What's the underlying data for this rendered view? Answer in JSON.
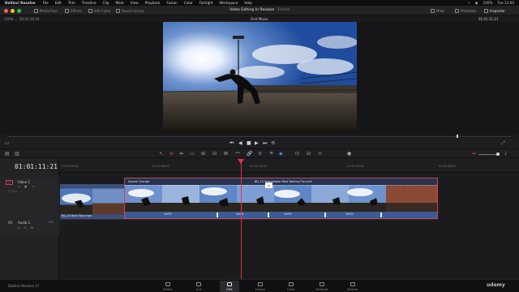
{
  "menubar": {
    "app_name": "DaVinci Resolve",
    "items": [
      "File",
      "Edit",
      "Trim",
      "Timeline",
      "Clip",
      "Mark",
      "View",
      "Playback",
      "Fusion",
      "Color",
      "Fairlight",
      "Workspace",
      "Help"
    ],
    "right": [
      "⌁",
      "◉",
      "100%",
      "Tue 12:00"
    ]
  },
  "toolbar": {
    "media_pool": "Media Pool",
    "effects": "Effects",
    "edit_index": "Edit Index",
    "sound_library": "Sound Library",
    "project_title": "Video Editing In Resolve",
    "edited": "Edited",
    "mixer": "Mixer",
    "metadata": "Metadata",
    "inspector": "Inspector"
  },
  "viewer": {
    "zoom": "120%",
    "left_timecode": "00:01:19:24",
    "timeline_name": "First Movie",
    "right_timecode": "01:01:11:21"
  },
  "timeline": {
    "timecode": "01:01:11:21",
    "ruler_ticks": [
      "01:00:00:00",
      "01:00:58:00",
      "01:01:14:00",
      "01:01:26:00",
      "01:01:38:00"
    ],
    "video_track": {
      "id": "V1",
      "name": "Video 1",
      "clip_count": "2 Clips"
    },
    "audio_track": {
      "id": "A1",
      "name": "Audio 1",
      "level": "2.0"
    },
    "clip_a_name": "BD_03 Roof Flips.mp4",
    "clip_b_name": "BD_13 Ulaanbaatar Roof Batting Flip.mp4",
    "speed_label": "Speed Change",
    "speed_markers": [
      "100%",
      "100%",
      "100%",
      "100%"
    ]
  },
  "pages": [
    "Media",
    "Cut",
    "Edit",
    "Fusion",
    "Color",
    "Fairlight",
    "Deliver"
  ],
  "footer": {
    "app_version": "DaVinci Resolve 17",
    "watermark": "udemy"
  }
}
